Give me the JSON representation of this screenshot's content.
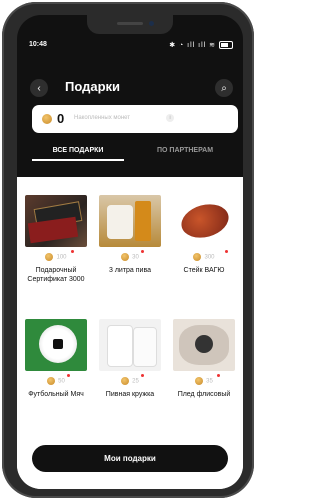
{
  "status": {
    "time": "10:48",
    "icons": "✱ ◔ ıll ıll ≋"
  },
  "header": {
    "title": "Подарки",
    "back_icon": "‹",
    "search_icon": "⌕"
  },
  "balance": {
    "value": "0",
    "label": "Накопленных монет",
    "info_icon": "i"
  },
  "tabs": {
    "all": "ВСЕ ПОДАРКИ",
    "partners": "ПО ПАРТНЕРАМ"
  },
  "gifts": [
    {
      "name": "Подарочный Сертификат 3000",
      "price": "100",
      "image": "certificate"
    },
    {
      "name": "3 литра пива",
      "price": "30",
      "image": "beer"
    },
    {
      "name": "Стейк ВАГЮ",
      "price": "300",
      "image": "steak"
    },
    {
      "name": "Футбольный Мяч",
      "price": "50",
      "image": "ball"
    },
    {
      "name": "Пивная кружка",
      "price": "25",
      "image": "mug"
    },
    {
      "name": "Плед флисовый",
      "price": "35",
      "image": "blanket"
    }
  ],
  "footer": {
    "button_label": "Мои подарки"
  },
  "colors": {
    "background": "#111111",
    "accent_dot": "#e33333",
    "coin": "#d9a24a"
  }
}
